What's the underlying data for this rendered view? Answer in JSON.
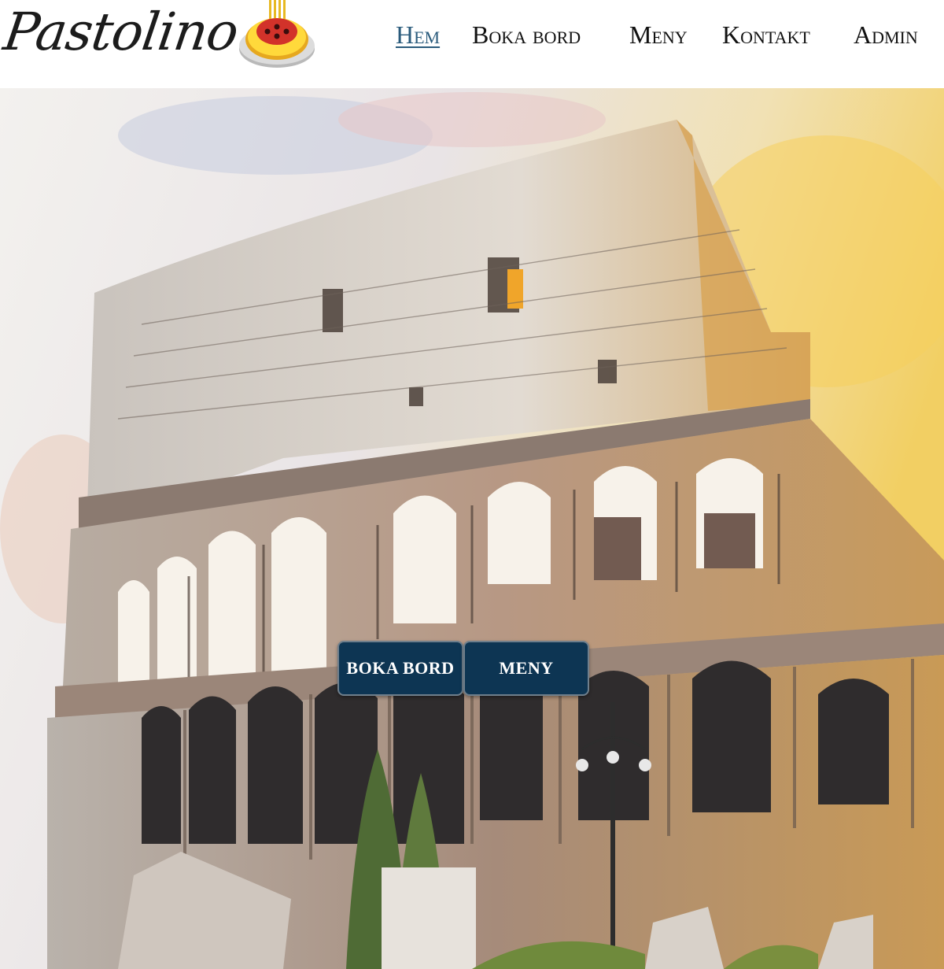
{
  "brand": {
    "name": "Pastolino",
    "logo_icon": "spaghetti-plate-icon"
  },
  "nav": {
    "items": [
      {
        "label": "Hem",
        "active": true
      },
      {
        "label": "Boka bord",
        "active": false
      },
      {
        "label": "Meny",
        "active": false
      },
      {
        "label": "Kontakt",
        "active": false
      },
      {
        "label": "Admin",
        "active": false
      }
    ]
  },
  "hero": {
    "image": "colosseum-watercolor-image",
    "buttons": {
      "book_label": "BOKA BORD",
      "menu_label": "MENY"
    }
  },
  "colors": {
    "accent": "#0d3553",
    "active_link": "#2a5b7c",
    "text": "#111111"
  }
}
